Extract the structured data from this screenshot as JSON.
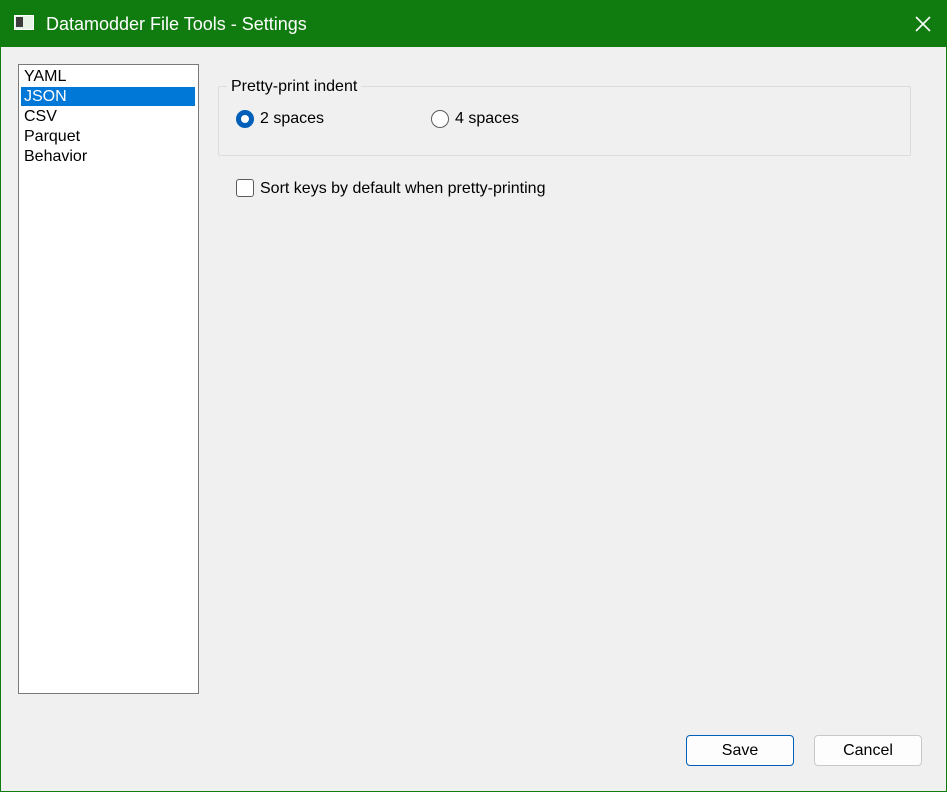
{
  "window": {
    "title": "Datamodder File Tools - Settings",
    "accent_color": "#107c10",
    "icons": {
      "app": "window-app-icon",
      "close": "close-icon"
    }
  },
  "sidebar": {
    "items": [
      {
        "label": "YAML",
        "selected": false
      },
      {
        "label": "JSON",
        "selected": true
      },
      {
        "label": "CSV",
        "selected": false
      },
      {
        "label": "Parquet",
        "selected": false
      },
      {
        "label": "Behavior",
        "selected": false
      }
    ],
    "selection_color": "#0078d7"
  },
  "json_settings": {
    "indent_group": {
      "title": "Pretty-print indent",
      "options": [
        {
          "label": "2 spaces",
          "checked": true
        },
        {
          "label": "4 spaces",
          "checked": false
        }
      ]
    },
    "sort_keys": {
      "label": "Sort keys by default when pretty-printing",
      "checked": false
    }
  },
  "footer": {
    "save_label": "Save",
    "cancel_label": "Cancel"
  }
}
